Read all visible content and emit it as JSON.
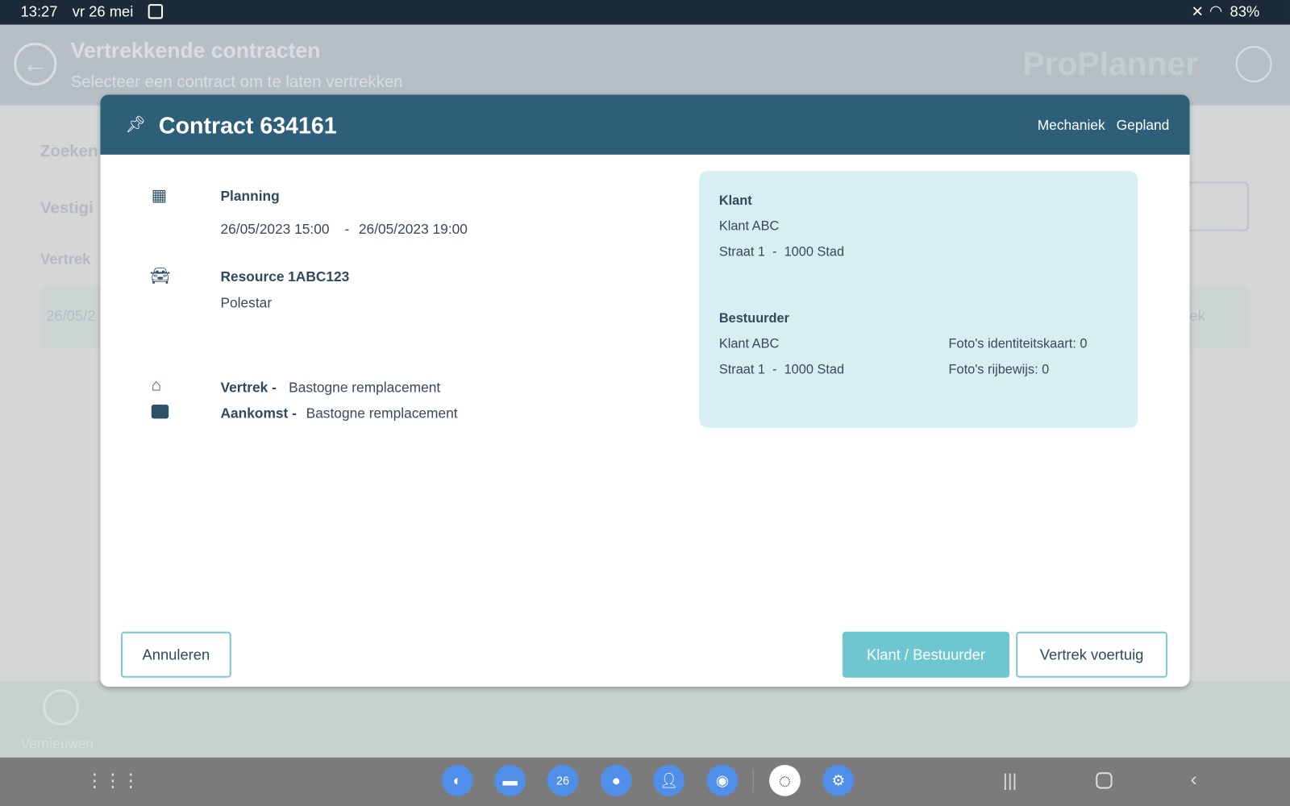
{
  "statusbar": {
    "time": "13:27",
    "date": "vr 26 mei",
    "battery": "83%"
  },
  "app": {
    "title": "Vertrekkende contracten",
    "subtitle": "Selecteer een contract om te laten vertrekken",
    "brand": "ProPlanner",
    "bg_labels": {
      "search": "Zoeken",
      "branch": "Vestigi",
      "departure": "Vertrek",
      "row_date": "26/05/2",
      "row_end": "ek",
      "refresh": "Vernieuwen"
    }
  },
  "modal": {
    "title": "Contract 634161",
    "tags": [
      "Mechaniek",
      "Gepland"
    ],
    "planning": {
      "label": "Planning",
      "start": "26/05/2023 15:00",
      "sep": "-",
      "end": "26/05/2023 19:00"
    },
    "resource": {
      "label": "Resource",
      "plate": "1ABC123",
      "model": "Polestar"
    },
    "departure": {
      "label": "Vertrek -",
      "location": "Bastogne remplacement"
    },
    "arrival": {
      "label": "Aankomst -",
      "location": "Bastogne remplacement"
    },
    "customer": {
      "heading": "Klant",
      "name": "Klant ABC",
      "address": "Straat 1  -  1000 Stad"
    },
    "driver": {
      "heading": "Bestuurder",
      "name": "Klant ABC",
      "address": "Straat 1  -  1000 Stad",
      "id_photos": "Foto's identiteitskaart: 0",
      "license_photos": "Foto's rijbewijs: 0"
    },
    "buttons": {
      "cancel": "Annuleren",
      "customer_driver": "Klant / Bestuurder",
      "depart": "Vertrek voertuig"
    }
  },
  "dock": {
    "calendar_day": "26"
  },
  "colors": {
    "header": "#2e5f78",
    "accent": "#6ec6d0",
    "panel": "#d7eef2"
  }
}
